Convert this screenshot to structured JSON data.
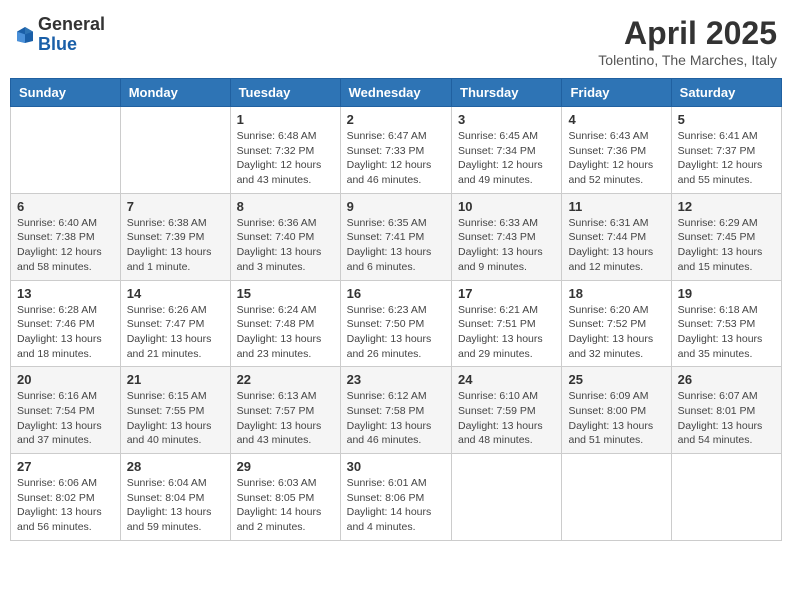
{
  "header": {
    "logo_general": "General",
    "logo_blue": "Blue",
    "month_title": "April 2025",
    "location": "Tolentino, The Marches, Italy"
  },
  "days_of_week": [
    "Sunday",
    "Monday",
    "Tuesday",
    "Wednesday",
    "Thursday",
    "Friday",
    "Saturday"
  ],
  "weeks": [
    [
      {
        "day": "",
        "sunrise": "",
        "sunset": "",
        "daylight": ""
      },
      {
        "day": "",
        "sunrise": "",
        "sunset": "",
        "daylight": ""
      },
      {
        "day": "1",
        "sunrise": "Sunrise: 6:48 AM",
        "sunset": "Sunset: 7:32 PM",
        "daylight": "Daylight: 12 hours and 43 minutes."
      },
      {
        "day": "2",
        "sunrise": "Sunrise: 6:47 AM",
        "sunset": "Sunset: 7:33 PM",
        "daylight": "Daylight: 12 hours and 46 minutes."
      },
      {
        "day": "3",
        "sunrise": "Sunrise: 6:45 AM",
        "sunset": "Sunset: 7:34 PM",
        "daylight": "Daylight: 12 hours and 49 minutes."
      },
      {
        "day": "4",
        "sunrise": "Sunrise: 6:43 AM",
        "sunset": "Sunset: 7:36 PM",
        "daylight": "Daylight: 12 hours and 52 minutes."
      },
      {
        "day": "5",
        "sunrise": "Sunrise: 6:41 AM",
        "sunset": "Sunset: 7:37 PM",
        "daylight": "Daylight: 12 hours and 55 minutes."
      }
    ],
    [
      {
        "day": "6",
        "sunrise": "Sunrise: 6:40 AM",
        "sunset": "Sunset: 7:38 PM",
        "daylight": "Daylight: 12 hours and 58 minutes."
      },
      {
        "day": "7",
        "sunrise": "Sunrise: 6:38 AM",
        "sunset": "Sunset: 7:39 PM",
        "daylight": "Daylight: 13 hours and 1 minute."
      },
      {
        "day": "8",
        "sunrise": "Sunrise: 6:36 AM",
        "sunset": "Sunset: 7:40 PM",
        "daylight": "Daylight: 13 hours and 3 minutes."
      },
      {
        "day": "9",
        "sunrise": "Sunrise: 6:35 AM",
        "sunset": "Sunset: 7:41 PM",
        "daylight": "Daylight: 13 hours and 6 minutes."
      },
      {
        "day": "10",
        "sunrise": "Sunrise: 6:33 AM",
        "sunset": "Sunset: 7:43 PM",
        "daylight": "Daylight: 13 hours and 9 minutes."
      },
      {
        "day": "11",
        "sunrise": "Sunrise: 6:31 AM",
        "sunset": "Sunset: 7:44 PM",
        "daylight": "Daylight: 13 hours and 12 minutes."
      },
      {
        "day": "12",
        "sunrise": "Sunrise: 6:29 AM",
        "sunset": "Sunset: 7:45 PM",
        "daylight": "Daylight: 13 hours and 15 minutes."
      }
    ],
    [
      {
        "day": "13",
        "sunrise": "Sunrise: 6:28 AM",
        "sunset": "Sunset: 7:46 PM",
        "daylight": "Daylight: 13 hours and 18 minutes."
      },
      {
        "day": "14",
        "sunrise": "Sunrise: 6:26 AM",
        "sunset": "Sunset: 7:47 PM",
        "daylight": "Daylight: 13 hours and 21 minutes."
      },
      {
        "day": "15",
        "sunrise": "Sunrise: 6:24 AM",
        "sunset": "Sunset: 7:48 PM",
        "daylight": "Daylight: 13 hours and 23 minutes."
      },
      {
        "day": "16",
        "sunrise": "Sunrise: 6:23 AM",
        "sunset": "Sunset: 7:50 PM",
        "daylight": "Daylight: 13 hours and 26 minutes."
      },
      {
        "day": "17",
        "sunrise": "Sunrise: 6:21 AM",
        "sunset": "Sunset: 7:51 PM",
        "daylight": "Daylight: 13 hours and 29 minutes."
      },
      {
        "day": "18",
        "sunrise": "Sunrise: 6:20 AM",
        "sunset": "Sunset: 7:52 PM",
        "daylight": "Daylight: 13 hours and 32 minutes."
      },
      {
        "day": "19",
        "sunrise": "Sunrise: 6:18 AM",
        "sunset": "Sunset: 7:53 PM",
        "daylight": "Daylight: 13 hours and 35 minutes."
      }
    ],
    [
      {
        "day": "20",
        "sunrise": "Sunrise: 6:16 AM",
        "sunset": "Sunset: 7:54 PM",
        "daylight": "Daylight: 13 hours and 37 minutes."
      },
      {
        "day": "21",
        "sunrise": "Sunrise: 6:15 AM",
        "sunset": "Sunset: 7:55 PM",
        "daylight": "Daylight: 13 hours and 40 minutes."
      },
      {
        "day": "22",
        "sunrise": "Sunrise: 6:13 AM",
        "sunset": "Sunset: 7:57 PM",
        "daylight": "Daylight: 13 hours and 43 minutes."
      },
      {
        "day": "23",
        "sunrise": "Sunrise: 6:12 AM",
        "sunset": "Sunset: 7:58 PM",
        "daylight": "Daylight: 13 hours and 46 minutes."
      },
      {
        "day": "24",
        "sunrise": "Sunrise: 6:10 AM",
        "sunset": "Sunset: 7:59 PM",
        "daylight": "Daylight: 13 hours and 48 minutes."
      },
      {
        "day": "25",
        "sunrise": "Sunrise: 6:09 AM",
        "sunset": "Sunset: 8:00 PM",
        "daylight": "Daylight: 13 hours and 51 minutes."
      },
      {
        "day": "26",
        "sunrise": "Sunrise: 6:07 AM",
        "sunset": "Sunset: 8:01 PM",
        "daylight": "Daylight: 13 hours and 54 minutes."
      }
    ],
    [
      {
        "day": "27",
        "sunrise": "Sunrise: 6:06 AM",
        "sunset": "Sunset: 8:02 PM",
        "daylight": "Daylight: 13 hours and 56 minutes."
      },
      {
        "day": "28",
        "sunrise": "Sunrise: 6:04 AM",
        "sunset": "Sunset: 8:04 PM",
        "daylight": "Daylight: 13 hours and 59 minutes."
      },
      {
        "day": "29",
        "sunrise": "Sunrise: 6:03 AM",
        "sunset": "Sunset: 8:05 PM",
        "daylight": "Daylight: 14 hours and 2 minutes."
      },
      {
        "day": "30",
        "sunrise": "Sunrise: 6:01 AM",
        "sunset": "Sunset: 8:06 PM",
        "daylight": "Daylight: 14 hours and 4 minutes."
      },
      {
        "day": "",
        "sunrise": "",
        "sunset": "",
        "daylight": ""
      },
      {
        "day": "",
        "sunrise": "",
        "sunset": "",
        "daylight": ""
      },
      {
        "day": "",
        "sunrise": "",
        "sunset": "",
        "daylight": ""
      }
    ]
  ]
}
